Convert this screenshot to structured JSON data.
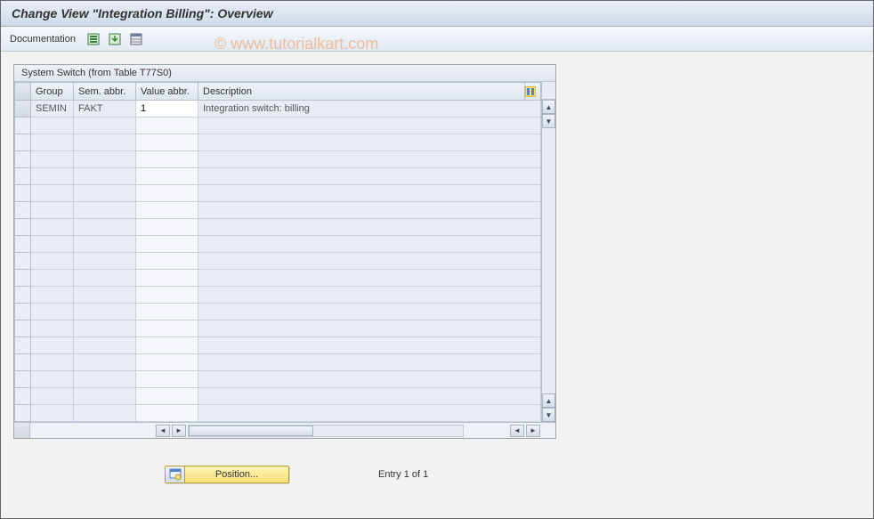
{
  "title": "Change View \"Integration Billing\": Overview",
  "toolbar": {
    "documentation_label": "Documentation"
  },
  "watermark": "© www.tutorialkart.com",
  "panel": {
    "header": "System Switch (from Table T77S0)",
    "columns": {
      "group": "Group",
      "sem": "Sem. abbr.",
      "val": "Value abbr.",
      "desc": "Description"
    }
  },
  "rows": [
    {
      "group": "SEMIN",
      "sem": "FAKT",
      "val": "1",
      "desc": "Integration switch: billing"
    }
  ],
  "footer": {
    "position_label": "Position...",
    "entry_text": "Entry 1 of 1"
  }
}
